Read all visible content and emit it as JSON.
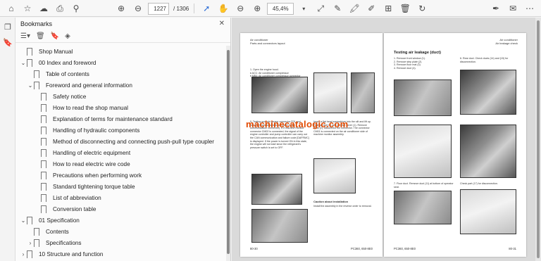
{
  "toolbar": {
    "page_current": "1227",
    "page_total": "/ 1306",
    "zoom": "45,4%"
  },
  "panel": {
    "title": "Bookmarks"
  },
  "bookmarks": [
    {
      "label": "Shop Manual",
      "indent": 0,
      "chevron": ""
    },
    {
      "label": "00 Index and foreword",
      "indent": 0,
      "chevron": "v"
    },
    {
      "label": "Table of contents",
      "indent": 1,
      "chevron": ""
    },
    {
      "label": "Foreword and general information",
      "indent": 1,
      "chevron": "v"
    },
    {
      "label": "Safety notice",
      "indent": 2,
      "chevron": ""
    },
    {
      "label": "How to read the shop manual",
      "indent": 2,
      "chevron": ""
    },
    {
      "label": "Explanation of terms for maintenance standard",
      "indent": 2,
      "chevron": ""
    },
    {
      "label": "Handling of hydraulic components",
      "indent": 2,
      "chevron": ""
    },
    {
      "label": "Method of disconnecting and connecting push-pull type coupler",
      "indent": 2,
      "chevron": ""
    },
    {
      "label": "Handling of electric equipment",
      "indent": 2,
      "chevron": ""
    },
    {
      "label": "How to read electric wire code",
      "indent": 2,
      "chevron": ""
    },
    {
      "label": "Precautions when performing work",
      "indent": 2,
      "chevron": ""
    },
    {
      "label": "Standard tightening torque table",
      "indent": 2,
      "chevron": ""
    },
    {
      "label": "List of abbreviation",
      "indent": 2,
      "chevron": ""
    },
    {
      "label": "Conversion table",
      "indent": 2,
      "chevron": ""
    },
    {
      "label": "01 Specification",
      "indent": 0,
      "chevron": "v"
    },
    {
      "label": "Contents",
      "indent": 1,
      "chevron": ""
    },
    {
      "label": "Specifications",
      "indent": 1,
      "chevron": ">"
    },
    {
      "label": "10 Structure and function",
      "indent": 0,
      "chevron": ">"
    }
  ],
  "document": {
    "left_header": "Air conditioner\nParts and connectors layout",
    "right_header": "Air conditioner\nAir leakage check",
    "right_section_title": "Testing air leakage (duct)",
    "left_footer_page": "80-30",
    "left_footer_model": "PC360, 650-8E0",
    "right_footer_model": "PC360, 650-8E0",
    "right_footer_page": "80-31",
    "caution_title": "Caution about installation"
  },
  "watermark": "machinecatalogic.com"
}
